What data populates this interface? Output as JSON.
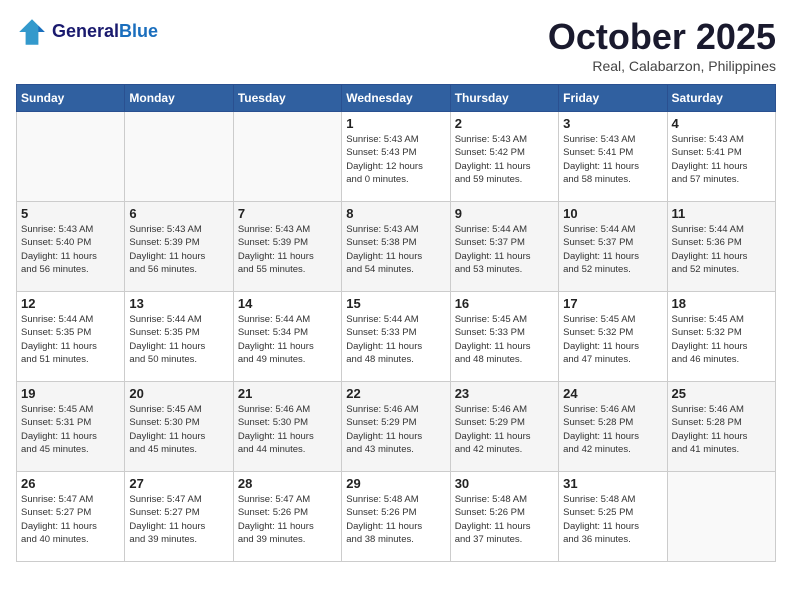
{
  "header": {
    "logo_line1": "General",
    "logo_line2": "Blue",
    "month": "October 2025",
    "location": "Real, Calabarzon, Philippines"
  },
  "days_of_week": [
    "Sunday",
    "Monday",
    "Tuesday",
    "Wednesday",
    "Thursday",
    "Friday",
    "Saturday"
  ],
  "weeks": [
    [
      {
        "day": "",
        "info": ""
      },
      {
        "day": "",
        "info": ""
      },
      {
        "day": "",
        "info": ""
      },
      {
        "day": "1",
        "info": "Sunrise: 5:43 AM\nSunset: 5:43 PM\nDaylight: 12 hours\nand 0 minutes."
      },
      {
        "day": "2",
        "info": "Sunrise: 5:43 AM\nSunset: 5:42 PM\nDaylight: 11 hours\nand 59 minutes."
      },
      {
        "day": "3",
        "info": "Sunrise: 5:43 AM\nSunset: 5:41 PM\nDaylight: 11 hours\nand 58 minutes."
      },
      {
        "day": "4",
        "info": "Sunrise: 5:43 AM\nSunset: 5:41 PM\nDaylight: 11 hours\nand 57 minutes."
      }
    ],
    [
      {
        "day": "5",
        "info": "Sunrise: 5:43 AM\nSunset: 5:40 PM\nDaylight: 11 hours\nand 56 minutes."
      },
      {
        "day": "6",
        "info": "Sunrise: 5:43 AM\nSunset: 5:39 PM\nDaylight: 11 hours\nand 56 minutes."
      },
      {
        "day": "7",
        "info": "Sunrise: 5:43 AM\nSunset: 5:39 PM\nDaylight: 11 hours\nand 55 minutes."
      },
      {
        "day": "8",
        "info": "Sunrise: 5:43 AM\nSunset: 5:38 PM\nDaylight: 11 hours\nand 54 minutes."
      },
      {
        "day": "9",
        "info": "Sunrise: 5:44 AM\nSunset: 5:37 PM\nDaylight: 11 hours\nand 53 minutes."
      },
      {
        "day": "10",
        "info": "Sunrise: 5:44 AM\nSunset: 5:37 PM\nDaylight: 11 hours\nand 52 minutes."
      },
      {
        "day": "11",
        "info": "Sunrise: 5:44 AM\nSunset: 5:36 PM\nDaylight: 11 hours\nand 52 minutes."
      }
    ],
    [
      {
        "day": "12",
        "info": "Sunrise: 5:44 AM\nSunset: 5:35 PM\nDaylight: 11 hours\nand 51 minutes."
      },
      {
        "day": "13",
        "info": "Sunrise: 5:44 AM\nSunset: 5:35 PM\nDaylight: 11 hours\nand 50 minutes."
      },
      {
        "day": "14",
        "info": "Sunrise: 5:44 AM\nSunset: 5:34 PM\nDaylight: 11 hours\nand 49 minutes."
      },
      {
        "day": "15",
        "info": "Sunrise: 5:44 AM\nSunset: 5:33 PM\nDaylight: 11 hours\nand 48 minutes."
      },
      {
        "day": "16",
        "info": "Sunrise: 5:45 AM\nSunset: 5:33 PM\nDaylight: 11 hours\nand 48 minutes."
      },
      {
        "day": "17",
        "info": "Sunrise: 5:45 AM\nSunset: 5:32 PM\nDaylight: 11 hours\nand 47 minutes."
      },
      {
        "day": "18",
        "info": "Sunrise: 5:45 AM\nSunset: 5:32 PM\nDaylight: 11 hours\nand 46 minutes."
      }
    ],
    [
      {
        "day": "19",
        "info": "Sunrise: 5:45 AM\nSunset: 5:31 PM\nDaylight: 11 hours\nand 45 minutes."
      },
      {
        "day": "20",
        "info": "Sunrise: 5:45 AM\nSunset: 5:30 PM\nDaylight: 11 hours\nand 45 minutes."
      },
      {
        "day": "21",
        "info": "Sunrise: 5:46 AM\nSunset: 5:30 PM\nDaylight: 11 hours\nand 44 minutes."
      },
      {
        "day": "22",
        "info": "Sunrise: 5:46 AM\nSunset: 5:29 PM\nDaylight: 11 hours\nand 43 minutes."
      },
      {
        "day": "23",
        "info": "Sunrise: 5:46 AM\nSunset: 5:29 PM\nDaylight: 11 hours\nand 42 minutes."
      },
      {
        "day": "24",
        "info": "Sunrise: 5:46 AM\nSunset: 5:28 PM\nDaylight: 11 hours\nand 42 minutes."
      },
      {
        "day": "25",
        "info": "Sunrise: 5:46 AM\nSunset: 5:28 PM\nDaylight: 11 hours\nand 41 minutes."
      }
    ],
    [
      {
        "day": "26",
        "info": "Sunrise: 5:47 AM\nSunset: 5:27 PM\nDaylight: 11 hours\nand 40 minutes."
      },
      {
        "day": "27",
        "info": "Sunrise: 5:47 AM\nSunset: 5:27 PM\nDaylight: 11 hours\nand 39 minutes."
      },
      {
        "day": "28",
        "info": "Sunrise: 5:47 AM\nSunset: 5:26 PM\nDaylight: 11 hours\nand 39 minutes."
      },
      {
        "day": "29",
        "info": "Sunrise: 5:48 AM\nSunset: 5:26 PM\nDaylight: 11 hours\nand 38 minutes."
      },
      {
        "day": "30",
        "info": "Sunrise: 5:48 AM\nSunset: 5:26 PM\nDaylight: 11 hours\nand 37 minutes."
      },
      {
        "day": "31",
        "info": "Sunrise: 5:48 AM\nSunset: 5:25 PM\nDaylight: 11 hours\nand 36 minutes."
      },
      {
        "day": "",
        "info": ""
      }
    ]
  ]
}
